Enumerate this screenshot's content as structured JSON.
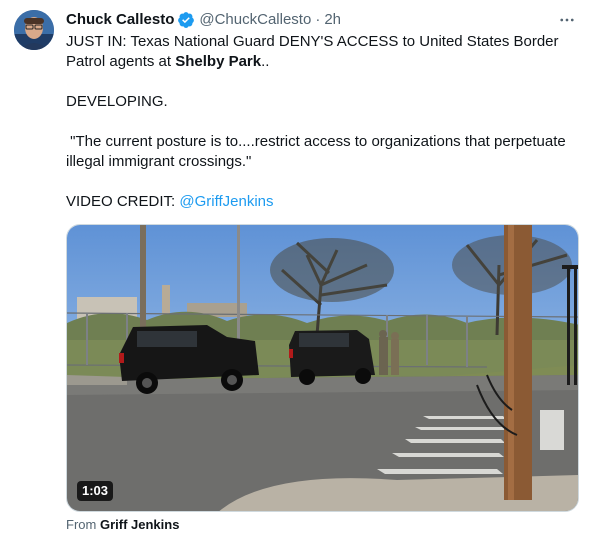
{
  "author": {
    "name": "Chuck Callesto",
    "handle": "@ChuckCallesto",
    "separator": "·",
    "time": "2h",
    "verified_color": "#1d9bf0"
  },
  "tweet": {
    "line1_prefix": "JUST IN: Texas National Guard DENY'S ACCESS to United States Border Patrol agents at ",
    "line1_bold": "Shelby Park",
    "line1_suffix": "..",
    "line2": "DEVELOPING.",
    "line3": " \"The current posture is to....restrict access to organizations that perpetuate illegal immigrant crossings.\"",
    "credit_prefix": "VIDEO CREDIT: ",
    "credit_mention": "@GriffJenkins"
  },
  "media": {
    "type": "video",
    "duration": "1:03"
  },
  "source": {
    "prefix": "From ",
    "name": "Griff Jenkins"
  },
  "icons": {
    "more": "more-icon",
    "verified": "verified-badge-icon"
  },
  "colors": {
    "link": "#1d9bf0",
    "secondary_text": "#536471"
  }
}
